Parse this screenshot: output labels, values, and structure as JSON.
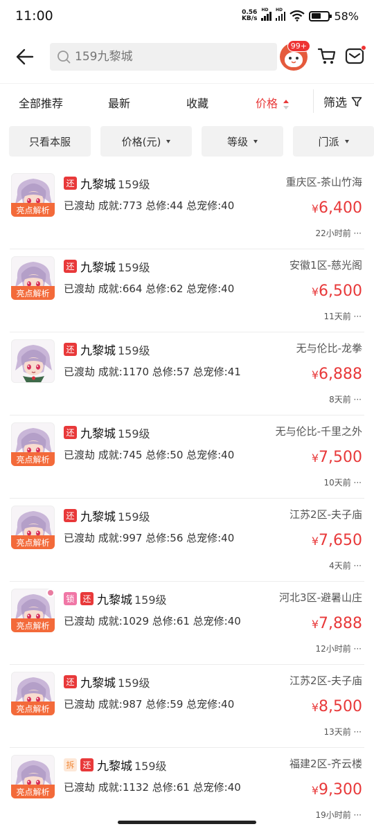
{
  "status_bar": {
    "time": "11:00",
    "net_speed_value": "0.56",
    "net_speed_unit": "KB/s",
    "signal1_label": "HD",
    "signal2_label": "HD",
    "battery_percent": "58%",
    "battery_level": 0.58,
    "icons": [
      "hd-signal-icon",
      "hd-signal-icon",
      "wifi-icon",
      "battery-icon"
    ]
  },
  "header": {
    "search_placeholder": "159九黎城",
    "notification_badge": "99+",
    "icons": [
      "back-arrow-icon",
      "search-icon",
      "mascot-avatar",
      "cart-icon",
      "mail-icon"
    ]
  },
  "sort_tabs": [
    {
      "label": "全部推荐",
      "active": false
    },
    {
      "label": "最新",
      "active": false
    },
    {
      "label": "收藏",
      "active": false
    },
    {
      "label": "价格",
      "active": true
    }
  ],
  "filter_label": "筛选",
  "chips": [
    {
      "label": "只看本服",
      "dropdown": false
    },
    {
      "label": "价格(元)",
      "dropdown": true
    },
    {
      "label": "等级",
      "dropdown": true
    },
    {
      "label": "门派",
      "dropdown": true
    }
  ],
  "highlight_label": "亮点解析",
  "tag_labels": {
    "huan": "还",
    "suo": "锁",
    "chai": "拆"
  },
  "items": [
    {
      "server": "九黎城",
      "level": "159级",
      "stats": "已渡劫 成就:773 总修:44 总宠修:40",
      "region": "重庆区-茶山竹海",
      "currency": "¥",
      "price": "6,400",
      "time": "22小时前 ···",
      "highlight": true,
      "tags": [
        "huan"
      ]
    },
    {
      "server": "九黎城",
      "level": "159级",
      "stats": "已渡劫 成就:664 总修:62 总宠修:40",
      "region": "安徽1区-慈光阁",
      "currency": "¥",
      "price": "6,500",
      "time": "11天前 ···",
      "highlight": true,
      "tags": [
        "huan"
      ]
    },
    {
      "server": "九黎城",
      "level": "159级",
      "stats": "已渡劫 成就:1170 总修:57 总宠修:41",
      "region": "无与伦比-龙拳",
      "currency": "¥",
      "price": "6,888",
      "time": "8天前 ···",
      "highlight": false,
      "tags": [
        "huan"
      ]
    },
    {
      "server": "九黎城",
      "level": "159级",
      "stats": "已渡劫 成就:745 总修:50 总宠修:40",
      "region": "无与伦比-千里之外",
      "currency": "¥",
      "price": "7,500",
      "time": "10天前 ···",
      "highlight": true,
      "tags": [
        "huan"
      ]
    },
    {
      "server": "九黎城",
      "level": "159级",
      "stats": "已渡劫 成就:997 总修:56 总宠修:40",
      "region": "江苏2区-夫子庙",
      "currency": "¥",
      "price": "7,650",
      "time": "4天前 ···",
      "highlight": true,
      "tags": [
        "huan"
      ]
    },
    {
      "server": "九黎城",
      "level": "159级",
      "stats": "已渡劫 成就:1029 总修:61 总宠修:40",
      "region": "河北3区-避暑山庄",
      "currency": "¥",
      "price": "7,888",
      "time": "12小时前 ···",
      "highlight": true,
      "tags": [
        "suo",
        "huan"
      ],
      "lock_dot": true
    },
    {
      "server": "九黎城",
      "level": "159级",
      "stats": "已渡劫 成就:987 总修:59 总宠修:40",
      "region": "江苏2区-夫子庙",
      "currency": "¥",
      "price": "8,500",
      "time": "13天前 ···",
      "highlight": true,
      "tags": [
        "huan"
      ]
    },
    {
      "server": "九黎城",
      "level": "159级",
      "stats": "已渡劫 成就:1132 总修:61 总宠修:40",
      "region": "福建2区-齐云楼",
      "currency": "¥",
      "price": "9,300",
      "time": "19小时前 ···",
      "highlight": true,
      "tags": [
        "chai",
        "huan"
      ]
    }
  ],
  "colors": {
    "accent_red": "#e8393a",
    "highlight_orange": "#f36a3a",
    "chip_bg": "#f2f2f2"
  }
}
